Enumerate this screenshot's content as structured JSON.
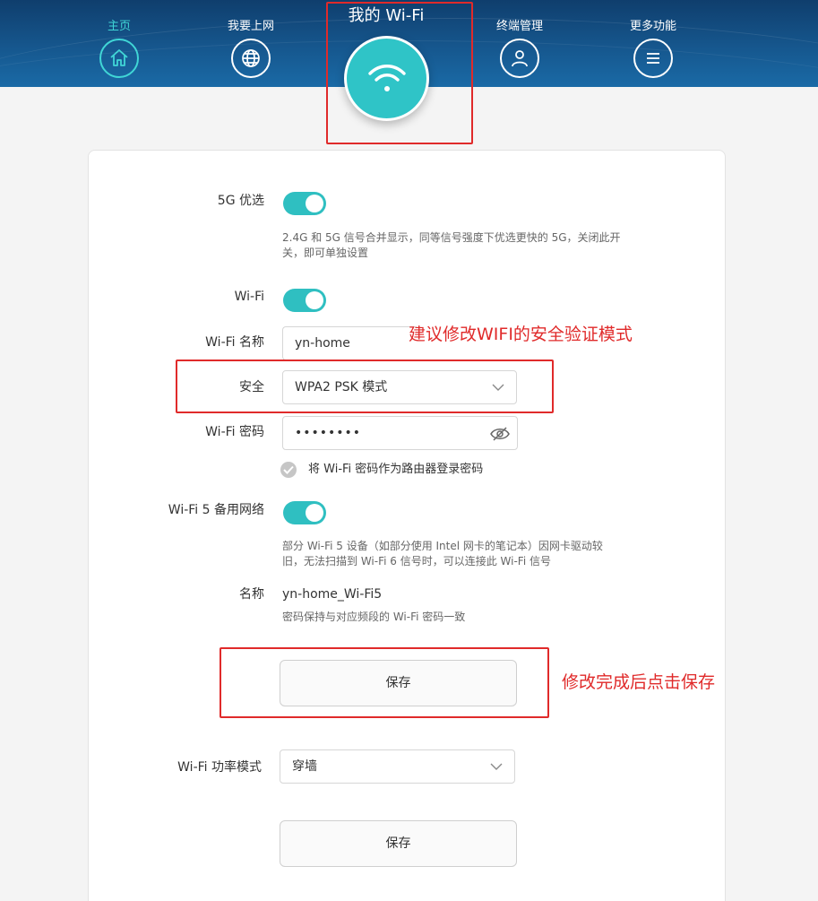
{
  "nav": {
    "home": "主页",
    "internet": "我要上网",
    "wifi": "我的 Wi-Fi",
    "devices": "终端管理",
    "more": "更多功能"
  },
  "icons": [
    "home-icon",
    "globe-icon",
    "wifi-icon",
    "user-icon",
    "menu-icon",
    "chevron-down-icon",
    "eye-icon",
    "checkmark-icon"
  ],
  "colors": {
    "accent": "#2fc4c7",
    "header": "#16578e",
    "annotation": "#e02a2a"
  },
  "settings": {
    "band5g_label": "5G 优选",
    "band5g_desc": "2.4G 和 5G 信号合并显示，同等信号强度下优选更快的 5G，关闭此开关，即可单独设置",
    "band5g_on": true,
    "wifi_label": "Wi-Fi",
    "wifi_on": true,
    "ssid_label": "Wi-Fi 名称",
    "ssid_value": "yn-home",
    "security_label": "安全",
    "security_value": "WPA2 PSK 模式",
    "password_label": "Wi-Fi 密码",
    "password_value": "••••••••",
    "use_as_login": "将 Wi-Fi 密码作为路由器登录密码",
    "wifi5_label": "Wi-Fi 5 备用网络",
    "wifi5_on": true,
    "wifi5_desc": "部分 Wi-Fi 5 设备（如部分使用 Intel 网卡的笔记本）因网卡驱动较旧，无法扫描到 Wi-Fi 6 信号时，可以连接此 Wi-Fi 信号",
    "name_label": "名称",
    "name_value": "yn-home_Wi-Fi5",
    "name_desc": "密码保持与对应频段的 Wi-Fi 密码一致",
    "save1": "保存",
    "power_label": "Wi-Fi 功率模式",
    "power_value": "穿墙",
    "save2": "保存"
  },
  "annotations": {
    "security_tip": "建议修改WIFI的安全验证模式",
    "save_tip": "修改完成后点击保存"
  }
}
